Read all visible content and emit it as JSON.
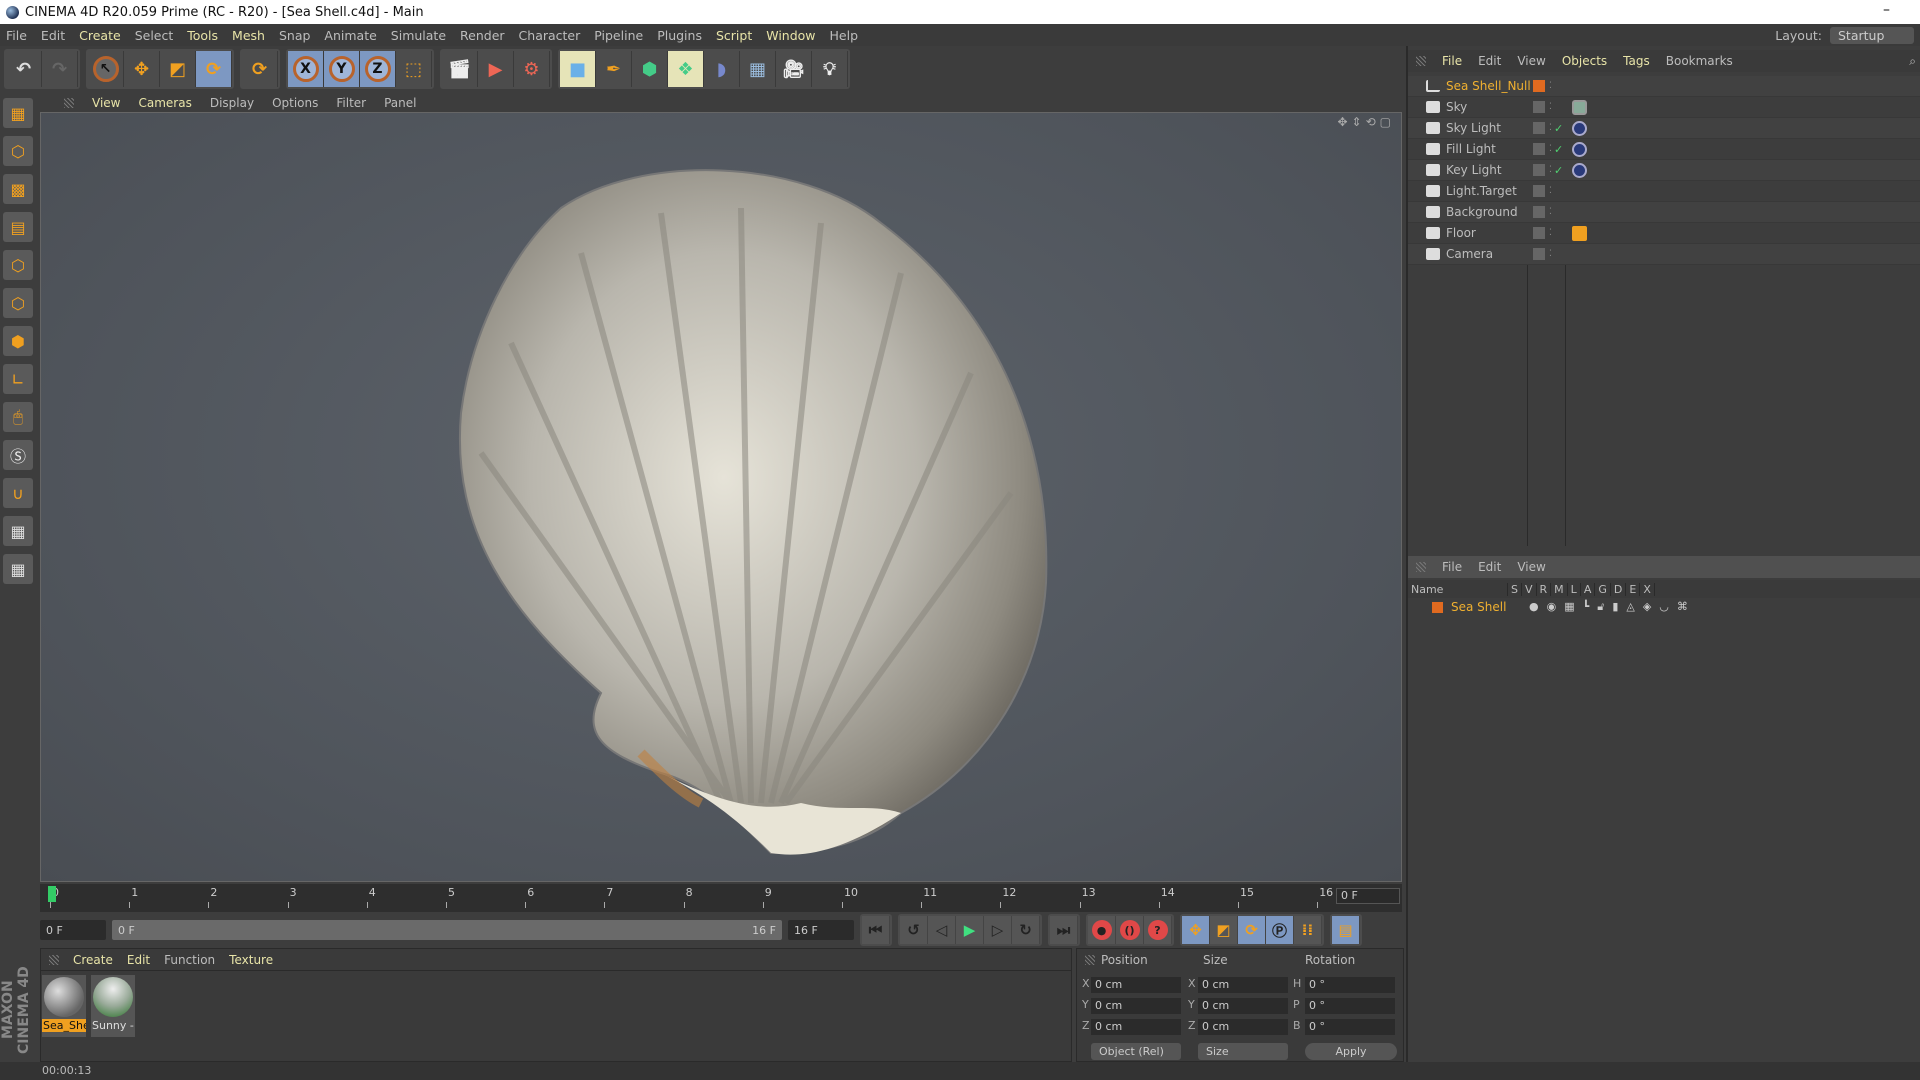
{
  "window": {
    "title": "CINEMA 4D R20.059 Prime (RC - R20) - [Sea Shell.c4d] - Main",
    "minimize": "–"
  },
  "menu": [
    "File",
    "Edit",
    "Create",
    "Select",
    "Tools",
    "Mesh",
    "Snap",
    "Animate",
    "Simulate",
    "Render",
    "Character",
    "Pipeline",
    "Plugins",
    "Script",
    "Window",
    "Help"
  ],
  "layout": {
    "label": "Layout:",
    "value": "Startup"
  },
  "viewport": {
    "menu": [
      "View",
      "Cameras",
      "Display",
      "Options",
      "Filter",
      "Panel"
    ]
  },
  "timeline": {
    "ticks": [
      "0",
      "1",
      "2",
      "3",
      "4",
      "5",
      "6",
      "7",
      "8",
      "9",
      "10",
      "11",
      "12",
      "13",
      "14",
      "15",
      "16"
    ],
    "current": "0 F",
    "start": "0 F",
    "range_start": "0 F",
    "range_end": "16 F",
    "end": "16 F",
    "frame_display": "0 F"
  },
  "material_manager": {
    "menu": [
      "Create",
      "Edit",
      "Function",
      "Texture"
    ],
    "materials": [
      {
        "name": "Sea_She",
        "selected": true
      },
      {
        "name": "Sunny -",
        "selected": false
      }
    ]
  },
  "brand": "MAXON CINEMA 4D",
  "coordinates": {
    "headers": [
      "Position",
      "Size",
      "Rotation"
    ],
    "rows": [
      {
        "pa": "X",
        "pv": "0 cm",
        "sa": "X",
        "sv": "0 cm",
        "ra": "H",
        "rv": "0 °"
      },
      {
        "pa": "Y",
        "pv": "0 cm",
        "sa": "Y",
        "sv": "0 cm",
        "ra": "P",
        "rv": "0 °"
      },
      {
        "pa": "Z",
        "pv": "0 cm",
        "sa": "Z",
        "sv": "0 cm",
        "ra": "B",
        "rv": "0 °"
      }
    ],
    "mode": "Object (Rel)",
    "size_mode": "Size",
    "apply": "Apply"
  },
  "status": {
    "time": "00:00:13"
  },
  "object_manager": {
    "menu": [
      "File",
      "Edit",
      "View",
      "Objects",
      "Tags",
      "Bookmarks"
    ],
    "objects": [
      {
        "name": "Sea Shell_Null",
        "active": true,
        "check": false,
        "tag": ""
      },
      {
        "name": "Sky",
        "check": false,
        "tag": "sky"
      },
      {
        "name": "Sky Light",
        "check": true,
        "tag": "target"
      },
      {
        "name": "Fill Light",
        "check": true,
        "tag": "target"
      },
      {
        "name": "Key Light",
        "check": true,
        "tag": "target"
      },
      {
        "name": "Light.Target",
        "check": false,
        "tag": ""
      },
      {
        "name": "Background",
        "check": false,
        "tag": ""
      },
      {
        "name": "Floor",
        "check": false,
        "tag": "render"
      },
      {
        "name": "Camera",
        "check": false,
        "tag": ""
      }
    ]
  },
  "layer_manager": {
    "menu": [
      "File",
      "Edit",
      "View"
    ],
    "columns": [
      "Name",
      "S",
      "V",
      "R",
      "M",
      "L",
      "A",
      "G",
      "D",
      "E",
      "X"
    ],
    "layers": [
      {
        "name": "Sea Shell",
        "color": "#e06a20"
      }
    ]
  },
  "colors": {
    "accent": "#f0a020",
    "active_text": "#f0b030",
    "selection": "#7d98c2"
  }
}
